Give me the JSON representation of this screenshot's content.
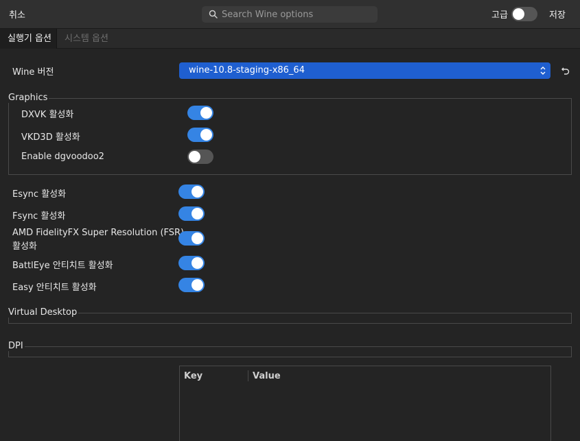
{
  "header": {
    "cancel_label": "취소",
    "search_placeholder": "Search Wine options",
    "advanced_label": "고급",
    "advanced_on": false,
    "save_label": "저장"
  },
  "tabs": [
    {
      "label": "실행기 옵션",
      "active": true
    },
    {
      "label": "시스템 옵션",
      "active": false
    }
  ],
  "wine_version": {
    "label": "Wine 버전",
    "value": "wine-10.8-staging-x86_64"
  },
  "graphics": {
    "title": "Graphics",
    "options": [
      {
        "label": "DXVK 활성화",
        "on": true
      },
      {
        "label": "VKD3D 활성화",
        "on": true
      },
      {
        "label": "Enable dgvoodoo2",
        "on": false
      }
    ]
  },
  "options": [
    {
      "label": "Esync 활성화",
      "on": true
    },
    {
      "label": "Fsync 활성화",
      "on": true
    },
    {
      "label_line1": "AMD FidelityFX Super Resolution (FSR)",
      "label_line2": "활성화",
      "on": true
    },
    {
      "label": "BattlEye 안티치트 활성화",
      "on": true
    },
    {
      "label": "Easy 안티치트 활성화",
      "on": true
    }
  ],
  "virtual_desktop": {
    "title": "Virtual Desktop"
  },
  "dpi": {
    "title": "DPI"
  },
  "env_table": {
    "columns": [
      "Key",
      "Value"
    ]
  },
  "colors": {
    "accent": "#3584e4",
    "combo": "#1f5fd0",
    "background": "#242424"
  }
}
